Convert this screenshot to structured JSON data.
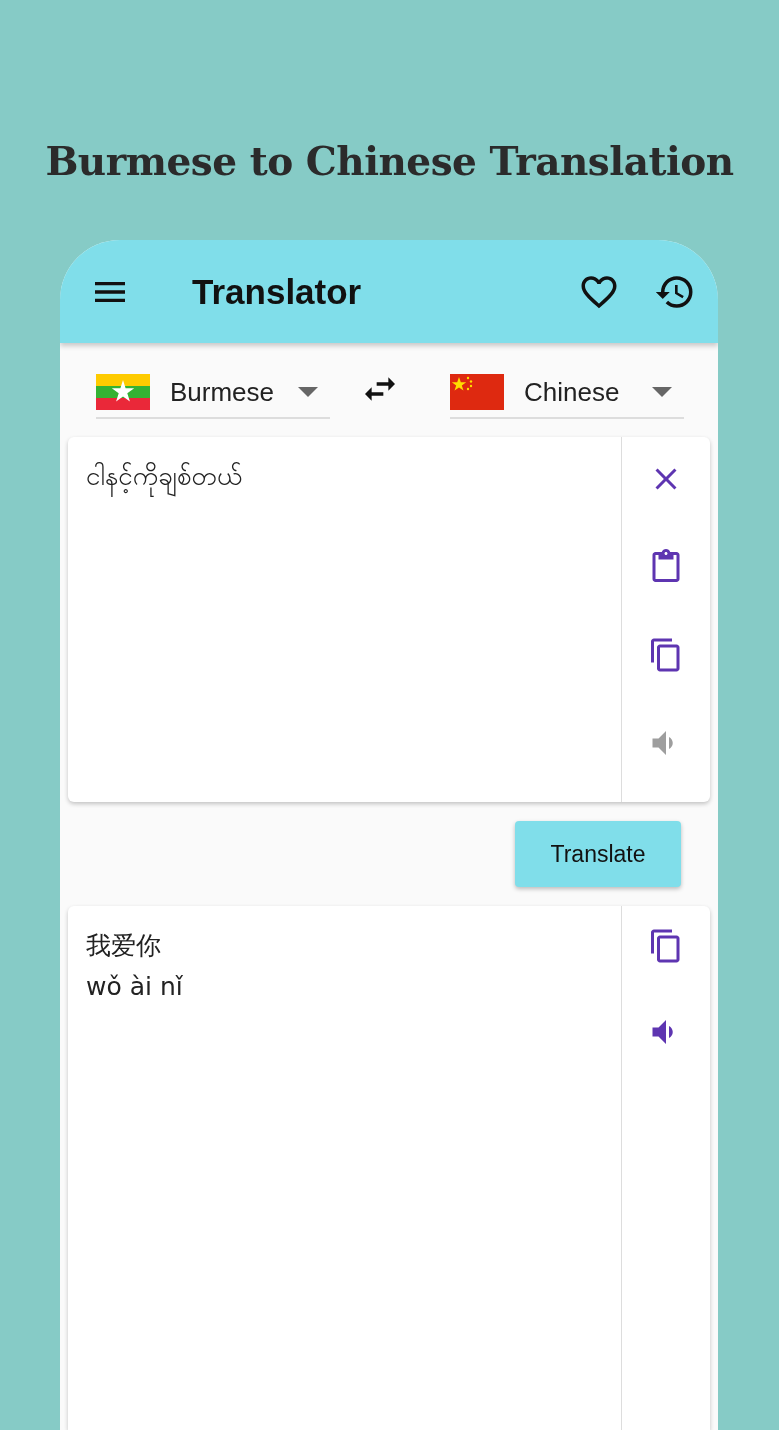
{
  "headline": "Burmese to Chinese Translation",
  "app_bar": {
    "title": "Translator"
  },
  "languages": [
    {
      "name": "Burmese",
      "kind": "myanmar"
    },
    {
      "name": "Chinese",
      "kind": "china"
    }
  ],
  "input": {
    "text": "ငါနင့်ကိုချစ်တယ်",
    "actions": [
      {
        "kind": "clear",
        "disabled": false
      },
      {
        "kind": "paste",
        "disabled": false
      },
      {
        "kind": "copy",
        "disabled": false
      },
      {
        "kind": "speak",
        "disabled": true
      }
    ]
  },
  "translate_button": "Translate",
  "output": {
    "lines": [
      "我爱你",
      "wǒ ài nǐ"
    ],
    "actions": [
      {
        "kind": "copy",
        "disabled": false
      },
      {
        "kind": "speak",
        "disabled": false
      }
    ]
  }
}
